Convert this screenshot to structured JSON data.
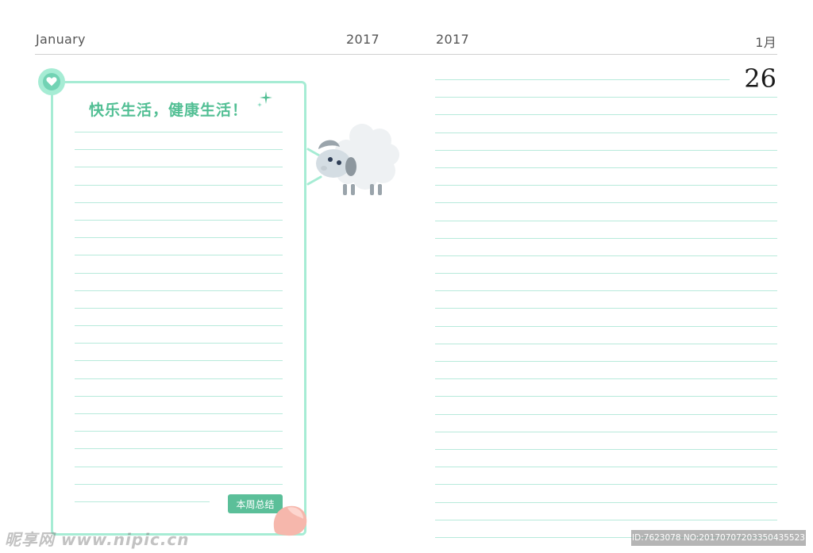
{
  "header": {
    "month_en": "January",
    "year_left": "2017",
    "year_right": "2017",
    "month_cn": "1月",
    "day": "26"
  },
  "left_page": {
    "motto": "快乐生活，健康生活！",
    "summary_button": "本周总结",
    "line_count": 22
  },
  "right_page": {
    "line_count": 27
  },
  "icons": {
    "badge": "heart-icon",
    "sparkle": "sparkle-icon",
    "mascot": "sheep-icon",
    "pointer": "finger-icon"
  },
  "colors": {
    "accent_light": "#a6ecd4",
    "accent": "#72d3b4",
    "accent_dark": "#52bf94",
    "ruled_line": "#b7eadb",
    "button": "#5bbf99"
  },
  "watermark": {
    "site": "昵享网 www.nipic.cn",
    "id_text": "ID:7623078 NO:20170707203350435523"
  }
}
